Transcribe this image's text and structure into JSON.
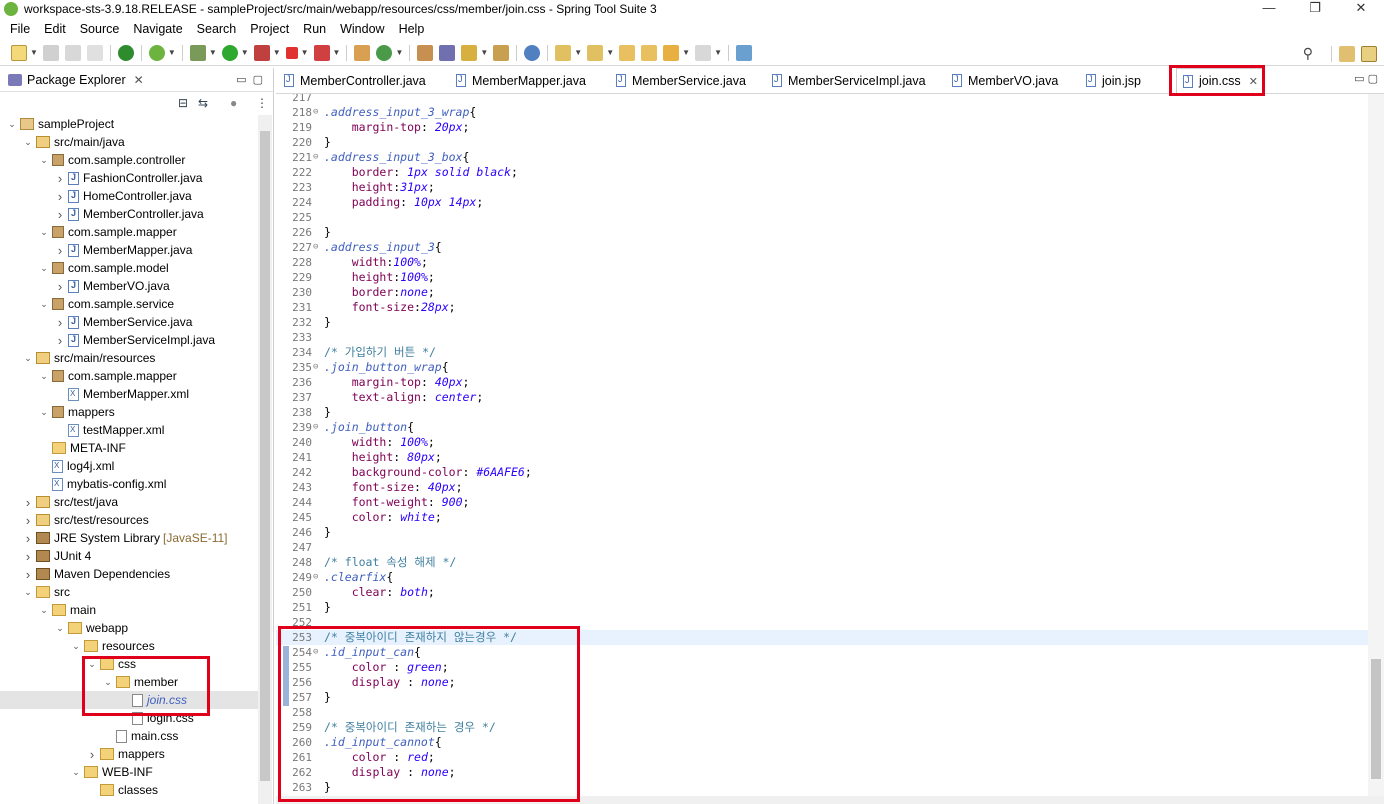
{
  "window": {
    "title": "workspace-sts-3.9.18.RELEASE - sampleProject/src/main/webapp/resources/css/member/join.css - Spring Tool Suite 3",
    "controls": [
      "—",
      "❐",
      "✕"
    ]
  },
  "menu": [
    "File",
    "Edit",
    "Source",
    "Navigate",
    "Search",
    "Project",
    "Run",
    "Window",
    "Help"
  ],
  "explorer": {
    "title": "Package Explorer",
    "close": "✕",
    "tree": [
      {
        "label": "sampleProject",
        "depth": 0,
        "icon": "project",
        "arrow": "v"
      },
      {
        "label": "src/main/java",
        "depth": 1,
        "icon": "srcfolder",
        "arrow": "v"
      },
      {
        "label": "com.sample.controller",
        "depth": 2,
        "icon": "package",
        "arrow": "v"
      },
      {
        "label": "FashionController.java",
        "depth": 3,
        "icon": "java",
        "arrow": ">"
      },
      {
        "label": "HomeController.java",
        "depth": 3,
        "icon": "java",
        "arrow": ">"
      },
      {
        "label": "MemberController.java",
        "depth": 3,
        "icon": "java",
        "arrow": ">"
      },
      {
        "label": "com.sample.mapper",
        "depth": 2,
        "icon": "package",
        "arrow": "v"
      },
      {
        "label": "MemberMapper.java",
        "depth": 3,
        "icon": "java",
        "arrow": ">"
      },
      {
        "label": "com.sample.model",
        "depth": 2,
        "icon": "package",
        "arrow": "v"
      },
      {
        "label": "MemberVO.java",
        "depth": 3,
        "icon": "java",
        "arrow": ">"
      },
      {
        "label": "com.sample.service",
        "depth": 2,
        "icon": "package",
        "arrow": "v"
      },
      {
        "label": "MemberService.java",
        "depth": 3,
        "icon": "java",
        "arrow": ">"
      },
      {
        "label": "MemberServiceImpl.java",
        "depth": 3,
        "icon": "java",
        "arrow": ">"
      },
      {
        "label": "src/main/resources",
        "depth": 1,
        "icon": "srcfolder",
        "arrow": "v"
      },
      {
        "label": "com.sample.mapper",
        "depth": 2,
        "icon": "package",
        "arrow": "v"
      },
      {
        "label": "MemberMapper.xml",
        "depth": 3,
        "icon": "xml",
        "arrow": ""
      },
      {
        "label": "mappers",
        "depth": 2,
        "icon": "package",
        "arrow": "v"
      },
      {
        "label": "testMapper.xml",
        "depth": 3,
        "icon": "xml",
        "arrow": ""
      },
      {
        "label": "META-INF",
        "depth": 2,
        "icon": "folder",
        "arrow": ""
      },
      {
        "label": "log4j.xml",
        "depth": 2,
        "icon": "xml",
        "arrow": ""
      },
      {
        "label": "mybatis-config.xml",
        "depth": 2,
        "icon": "xml",
        "arrow": ""
      },
      {
        "label": "src/test/java",
        "depth": 1,
        "icon": "srcfolder",
        "arrow": ">"
      },
      {
        "label": "src/test/resources",
        "depth": 1,
        "icon": "srcfolder",
        "arrow": ">"
      },
      {
        "label": "JRE System Library",
        "decor": "[JavaSE-11]",
        "depth": 1,
        "icon": "lib",
        "arrow": ">"
      },
      {
        "label": "JUnit 4",
        "depth": 1,
        "icon": "lib",
        "arrow": ">"
      },
      {
        "label": "Maven Dependencies",
        "depth": 1,
        "icon": "lib",
        "arrow": ">"
      },
      {
        "label": "src",
        "depth": 1,
        "icon": "folder",
        "arrow": "v"
      },
      {
        "label": "main",
        "depth": 2,
        "icon": "folder",
        "arrow": "v"
      },
      {
        "label": "webapp",
        "depth": 3,
        "icon": "folder",
        "arrow": "v"
      },
      {
        "label": "resources",
        "depth": 4,
        "icon": "folder",
        "arrow": "v"
      },
      {
        "label": "css",
        "depth": 5,
        "icon": "folder",
        "arrow": "v"
      },
      {
        "label": "member",
        "depth": 6,
        "icon": "folder",
        "arrow": "v"
      },
      {
        "label": "join.css",
        "depth": 7,
        "icon": "css",
        "arrow": "",
        "selected": true
      },
      {
        "label": "login.css",
        "depth": 7,
        "icon": "css",
        "arrow": ""
      },
      {
        "label": "main.css",
        "depth": 6,
        "icon": "css",
        "arrow": ""
      },
      {
        "label": "mappers",
        "depth": 5,
        "icon": "folder",
        "arrow": ">"
      },
      {
        "label": "WEB-INF",
        "depth": 4,
        "icon": "folder",
        "arrow": "v"
      },
      {
        "label": "classes",
        "depth": 5,
        "icon": "folder",
        "arrow": ""
      }
    ]
  },
  "tabs": [
    {
      "label": "MemberController.java",
      "active": false
    },
    {
      "label": "MemberMapper.java",
      "active": false
    },
    {
      "label": "MemberService.java",
      "active": false
    },
    {
      "label": "MemberServiceImpl.java",
      "active": false
    },
    {
      "label": "MemberVO.java",
      "active": false
    },
    {
      "label": "join.jsp",
      "active": false
    },
    {
      "label": "join.css",
      "active": true,
      "close": "✕"
    }
  ],
  "editor": {
    "current_line": 253,
    "lines": [
      {
        "n": 217,
        "parts": []
      },
      {
        "n": 218,
        "fold": true,
        "parts": [
          [
            "sel",
            ".address_input_3_wrap"
          ],
          [
            "pn",
            "{"
          ]
        ]
      },
      {
        "n": 219,
        "parts": [
          [
            "pn",
            "    "
          ],
          [
            "prop",
            "margin-top"
          ],
          [
            "pn",
            ": "
          ],
          [
            "val",
            "20px"
          ],
          [
            "pn",
            ";"
          ]
        ]
      },
      {
        "n": 220,
        "parts": [
          [
            "pn",
            "}"
          ]
        ]
      },
      {
        "n": 221,
        "fold": true,
        "parts": [
          [
            "sel",
            ".address_input_3_box"
          ],
          [
            "pn",
            "{"
          ]
        ]
      },
      {
        "n": 222,
        "parts": [
          [
            "pn",
            "    "
          ],
          [
            "prop",
            "border"
          ],
          [
            "pn",
            ": "
          ],
          [
            "val",
            "1px solid black"
          ],
          [
            "pn",
            ";"
          ]
        ]
      },
      {
        "n": 223,
        "parts": [
          [
            "pn",
            "    "
          ],
          [
            "prop",
            "height"
          ],
          [
            "pn",
            ":"
          ],
          [
            "val",
            "31px"
          ],
          [
            "pn",
            ";"
          ]
        ]
      },
      {
        "n": 224,
        "parts": [
          [
            "pn",
            "    "
          ],
          [
            "prop",
            "padding"
          ],
          [
            "pn",
            ": "
          ],
          [
            "val",
            "10px 14px"
          ],
          [
            "pn",
            ";"
          ]
        ]
      },
      {
        "n": 225,
        "parts": []
      },
      {
        "n": 226,
        "parts": [
          [
            "pn",
            "}"
          ]
        ]
      },
      {
        "n": 227,
        "fold": true,
        "parts": [
          [
            "sel",
            ".address_input_3"
          ],
          [
            "pn",
            "{"
          ]
        ]
      },
      {
        "n": 228,
        "parts": [
          [
            "pn",
            "    "
          ],
          [
            "prop",
            "width"
          ],
          [
            "pn",
            ":"
          ],
          [
            "val",
            "100%"
          ],
          [
            "pn",
            ";"
          ]
        ]
      },
      {
        "n": 229,
        "parts": [
          [
            "pn",
            "    "
          ],
          [
            "prop",
            "height"
          ],
          [
            "pn",
            ":"
          ],
          [
            "val",
            "100%"
          ],
          [
            "pn",
            ";"
          ]
        ]
      },
      {
        "n": 230,
        "parts": [
          [
            "pn",
            "    "
          ],
          [
            "prop",
            "border"
          ],
          [
            "pn",
            ":"
          ],
          [
            "val",
            "none"
          ],
          [
            "pn",
            ";"
          ]
        ]
      },
      {
        "n": 231,
        "parts": [
          [
            "pn",
            "    "
          ],
          [
            "prop",
            "font-size"
          ],
          [
            "pn",
            ":"
          ],
          [
            "val",
            "28px"
          ],
          [
            "pn",
            ";"
          ]
        ]
      },
      {
        "n": 232,
        "parts": [
          [
            "pn",
            "}"
          ]
        ]
      },
      {
        "n": 233,
        "parts": []
      },
      {
        "n": 234,
        "parts": [
          [
            "cmt",
            "/* 가입하기 버튼 */"
          ]
        ]
      },
      {
        "n": 235,
        "fold": true,
        "parts": [
          [
            "sel",
            ".join_button_wrap"
          ],
          [
            "pn",
            "{"
          ]
        ]
      },
      {
        "n": 236,
        "parts": [
          [
            "pn",
            "    "
          ],
          [
            "prop",
            "margin-top"
          ],
          [
            "pn",
            ": "
          ],
          [
            "val",
            "40px"
          ],
          [
            "pn",
            ";"
          ]
        ]
      },
      {
        "n": 237,
        "parts": [
          [
            "pn",
            "    "
          ],
          [
            "prop",
            "text-align"
          ],
          [
            "pn",
            ": "
          ],
          [
            "val",
            "center"
          ],
          [
            "pn",
            ";"
          ]
        ]
      },
      {
        "n": 238,
        "parts": [
          [
            "pn",
            "}"
          ]
        ]
      },
      {
        "n": 239,
        "fold": true,
        "parts": [
          [
            "sel",
            ".join_button"
          ],
          [
            "pn",
            "{"
          ]
        ]
      },
      {
        "n": 240,
        "parts": [
          [
            "pn",
            "    "
          ],
          [
            "prop",
            "width"
          ],
          [
            "pn",
            ": "
          ],
          [
            "val",
            "100%"
          ],
          [
            "pn",
            ";"
          ]
        ]
      },
      {
        "n": 241,
        "parts": [
          [
            "pn",
            "    "
          ],
          [
            "prop",
            "height"
          ],
          [
            "pn",
            ": "
          ],
          [
            "val",
            "80px"
          ],
          [
            "pn",
            ";"
          ]
        ]
      },
      {
        "n": 242,
        "parts": [
          [
            "pn",
            "    "
          ],
          [
            "prop",
            "background-color"
          ],
          [
            "pn",
            ": "
          ],
          [
            "val",
            "#6AAFE6"
          ],
          [
            "pn",
            ";"
          ]
        ]
      },
      {
        "n": 243,
        "parts": [
          [
            "pn",
            "    "
          ],
          [
            "prop",
            "font-size"
          ],
          [
            "pn",
            ": "
          ],
          [
            "val",
            "40px"
          ],
          [
            "pn",
            ";"
          ]
        ]
      },
      {
        "n": 244,
        "parts": [
          [
            "pn",
            "    "
          ],
          [
            "prop",
            "font-weight"
          ],
          [
            "pn",
            ": "
          ],
          [
            "val",
            "900"
          ],
          [
            "pn",
            ";"
          ]
        ]
      },
      {
        "n": 245,
        "parts": [
          [
            "pn",
            "    "
          ],
          [
            "prop",
            "color"
          ],
          [
            "pn",
            ": "
          ],
          [
            "val",
            "white"
          ],
          [
            "pn",
            ";"
          ]
        ]
      },
      {
        "n": 246,
        "parts": [
          [
            "pn",
            "}"
          ]
        ]
      },
      {
        "n": 247,
        "parts": []
      },
      {
        "n": 248,
        "parts": [
          [
            "cmt",
            "/* float 속성 해제 */"
          ]
        ]
      },
      {
        "n": 249,
        "fold": true,
        "parts": [
          [
            "sel",
            ".clearfix"
          ],
          [
            "pn",
            "{"
          ]
        ]
      },
      {
        "n": 250,
        "parts": [
          [
            "pn",
            "    "
          ],
          [
            "prop",
            "clear"
          ],
          [
            "pn",
            ": "
          ],
          [
            "val",
            "both"
          ],
          [
            "pn",
            ";"
          ]
        ]
      },
      {
        "n": 251,
        "parts": [
          [
            "pn",
            "}"
          ]
        ]
      },
      {
        "n": 252,
        "parts": []
      },
      {
        "n": 253,
        "parts": [
          [
            "cmt",
            "/* 중복아이디 존재하지 않는경우 */"
          ]
        ]
      },
      {
        "n": 254,
        "fold": true,
        "parts": [
          [
            "sel",
            ".id_input_can"
          ],
          [
            "pn",
            "{"
          ]
        ]
      },
      {
        "n": 255,
        "parts": [
          [
            "pn",
            "    "
          ],
          [
            "prop",
            "color"
          ],
          [
            "pn",
            " : "
          ],
          [
            "val",
            "green"
          ],
          [
            "pn",
            ";"
          ]
        ]
      },
      {
        "n": 256,
        "parts": [
          [
            "pn",
            "    "
          ],
          [
            "prop",
            "display"
          ],
          [
            "pn",
            " : "
          ],
          [
            "val",
            "none"
          ],
          [
            "pn",
            ";"
          ]
        ]
      },
      {
        "n": 257,
        "parts": [
          [
            "pn",
            "}"
          ]
        ]
      },
      {
        "n": 258,
        "parts": []
      },
      {
        "n": 259,
        "parts": [
          [
            "cmt",
            "/* 중복아이디 존재하는 경우 */"
          ]
        ]
      },
      {
        "n": 260,
        "parts": [
          [
            "sel",
            ".id_input_cannot"
          ],
          [
            "pn",
            "{"
          ]
        ]
      },
      {
        "n": 261,
        "parts": [
          [
            "pn",
            "    "
          ],
          [
            "prop",
            "color"
          ],
          [
            "pn",
            " : "
          ],
          [
            "val",
            "red"
          ],
          [
            "pn",
            ";"
          ]
        ]
      },
      {
        "n": 262,
        "parts": [
          [
            "pn",
            "    "
          ],
          [
            "prop",
            "display"
          ],
          [
            "pn",
            " : "
          ],
          [
            "val",
            "none"
          ],
          [
            "pn",
            ";"
          ]
        ]
      },
      {
        "n": 263,
        "parts": [
          [
            "pn",
            "}"
          ]
        ]
      }
    ]
  },
  "colors": {
    "highlight_box": "#e0001b",
    "selector": "#3f5fbf",
    "property": "#7f0055",
    "value": "#2a00ff",
    "comment": "#3f7f9f"
  }
}
